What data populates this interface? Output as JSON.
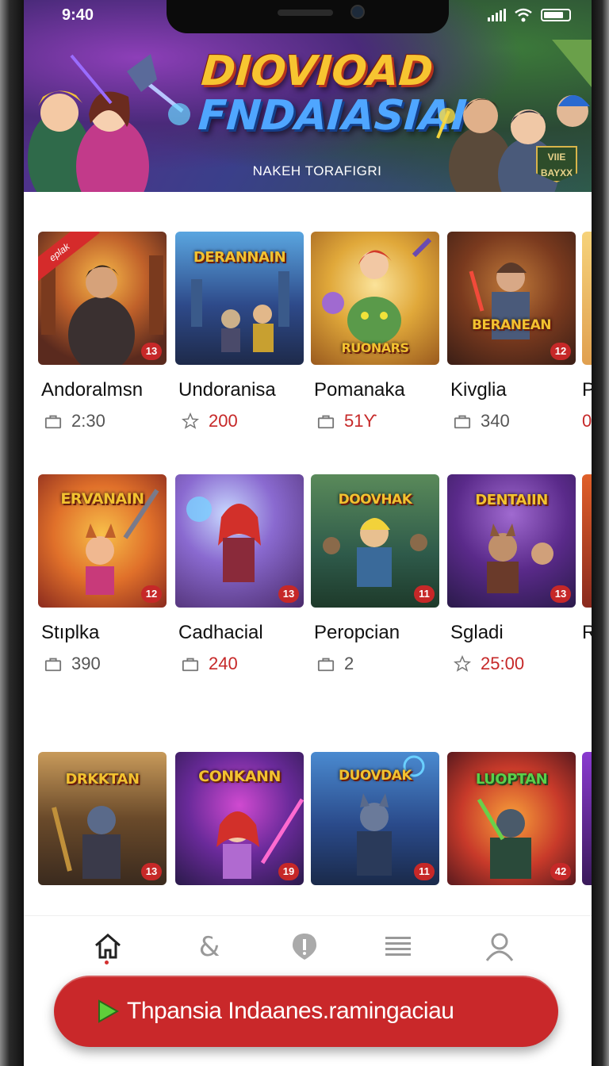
{
  "status": {
    "time": "9:40"
  },
  "banner": {
    "title_line1": "DIOVIOAD",
    "title_line2": "FNDAIASIAI",
    "subtitle": "NAKEH TORAFIGRI",
    "badge": "VIIE BAYXX"
  },
  "ribbon": "eplak",
  "cards": [
    {
      "name": "Andoralmsn",
      "meta_icon": "bag-icon",
      "value": "2:30",
      "value_red": false,
      "badge": "13",
      "logo": ""
    },
    {
      "name": "Undoranisa",
      "meta_icon": "star-icon",
      "value": "200",
      "value_red": true,
      "badge": "",
      "logo": "DERANNAIN"
    },
    {
      "name": "Pomanaka",
      "meta_icon": "bag-icon",
      "value": "51Ƴ",
      "value_red": true,
      "badge": "",
      "logo": "RUONARS"
    },
    {
      "name": "Kivglia",
      "meta_icon": "bag-icon",
      "value": "340",
      "value_red": false,
      "badge": "12",
      "logo": "BERANEAN"
    },
    {
      "name": "P",
      "meta_icon": "",
      "value": "0",
      "value_red": true,
      "badge": "",
      "logo": ""
    },
    {
      "name": "Stıplka",
      "meta_icon": "bag-icon",
      "value": "390",
      "value_red": false,
      "badge": "12",
      "logo": "ERVANAIN"
    },
    {
      "name": "Cadhacial",
      "meta_icon": "bag-icon",
      "value": "240",
      "value_red": true,
      "badge": "13",
      "logo": ""
    },
    {
      "name": "Peropcian",
      "meta_icon": "bag-icon",
      "value": "2",
      "value_red": false,
      "badge": "11",
      "logo": "DOOVHAK"
    },
    {
      "name": "Sgladi",
      "meta_icon": "star-icon",
      "value": "25:00",
      "value_red": true,
      "badge": "13",
      "logo": "DENTAIIN"
    },
    {
      "name": "R",
      "meta_icon": "",
      "value": "",
      "value_red": false,
      "badge": "",
      "logo": ""
    },
    {
      "name": "",
      "meta_icon": "",
      "value": "",
      "value_red": false,
      "badge": "13",
      "logo": "DRKKTAN"
    },
    {
      "name": "",
      "meta_icon": "",
      "value": "",
      "value_red": false,
      "badge": "19",
      "logo": "CONKANN"
    },
    {
      "name": "",
      "meta_icon": "",
      "value": "",
      "value_red": false,
      "badge": "11",
      "logo": "DUOVDAK"
    },
    {
      "name": "",
      "meta_icon": "",
      "value": "",
      "value_red": false,
      "badge": "42",
      "logo": "LUOPTAN"
    }
  ],
  "nav": [
    "home-icon",
    "ampersand-icon",
    "shield-icon",
    "menu-icon",
    "profile-icon"
  ],
  "cta": {
    "label": "Thpansia Indaanes.ramingaciau"
  },
  "colors": {
    "accent": "#c9282a",
    "title_gold": "#f7c531",
    "title_blue": "#4fa6ff"
  }
}
